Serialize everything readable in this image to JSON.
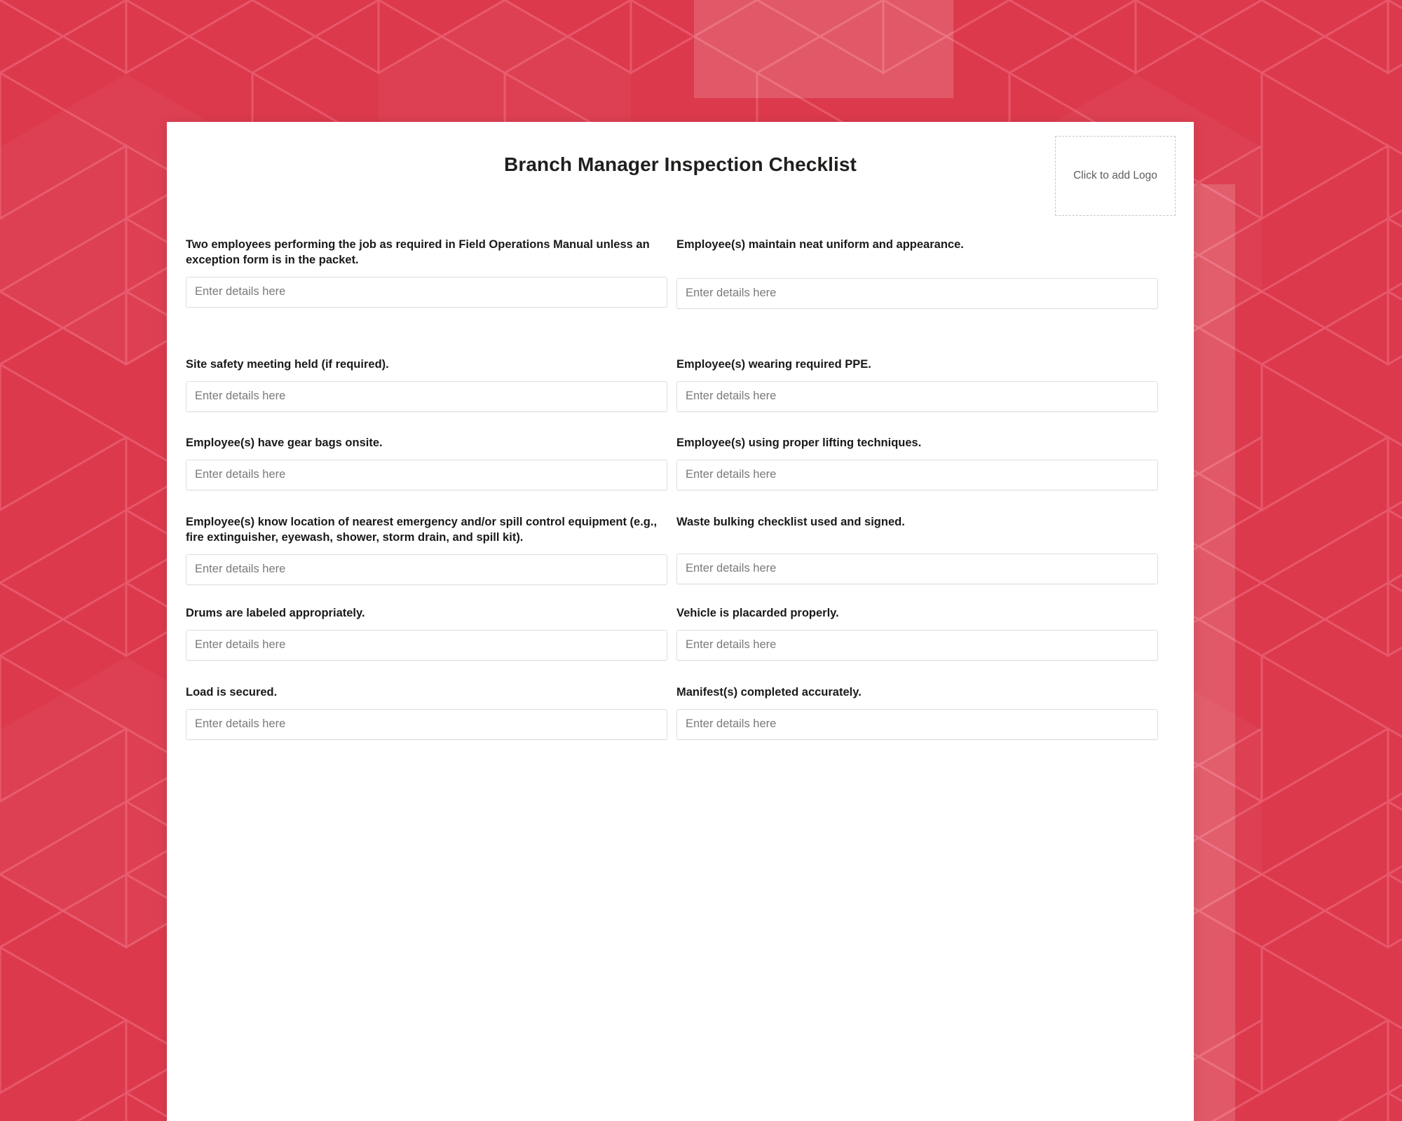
{
  "background": {
    "base_color": "#DC3A4C",
    "pattern_name": "isometric-cube-pattern",
    "line_color": "#E8556A",
    "band_color": "#E8798A"
  },
  "header": {
    "title": "Branch Manager Inspection Checklist",
    "logo_placeholder_label": "Click to add Logo"
  },
  "form": {
    "input_placeholder": "Enter details here",
    "rows": [
      {
        "left": {
          "label": "Two employees performing the job as required in Field Operations Manual unless an exception form is in the packet.",
          "value": ""
        },
        "right": {
          "label": "Employee(s) maintain neat uniform and appearance.",
          "value": ""
        }
      },
      {
        "left": {
          "label": "Site safety meeting held (if required).",
          "value": ""
        },
        "right": {
          "label": "Employee(s) wearing required PPE.",
          "value": ""
        }
      },
      {
        "left": {
          "label": "Employee(s) have gear bags onsite.",
          "value": ""
        },
        "right": {
          "label": "Employee(s) using proper lifting techniques.",
          "value": ""
        }
      },
      {
        "left": {
          "label": "Employee(s) know location of nearest emergency and/or spill control equipment (e.g., fire extinguisher, eyewash, shower, storm drain, and spill kit).",
          "value": ""
        },
        "right": {
          "label": "Waste bulking checklist used and signed.",
          "value": ""
        }
      },
      {
        "left": {
          "label": "Drums are labeled appropriately.",
          "value": ""
        },
        "right": {
          "label": "Vehicle is placarded properly.",
          "value": ""
        }
      },
      {
        "left": {
          "label": "Load is secured.",
          "value": ""
        },
        "right": {
          "label": "Manifest(s) completed accurately.",
          "value": ""
        }
      }
    ]
  }
}
